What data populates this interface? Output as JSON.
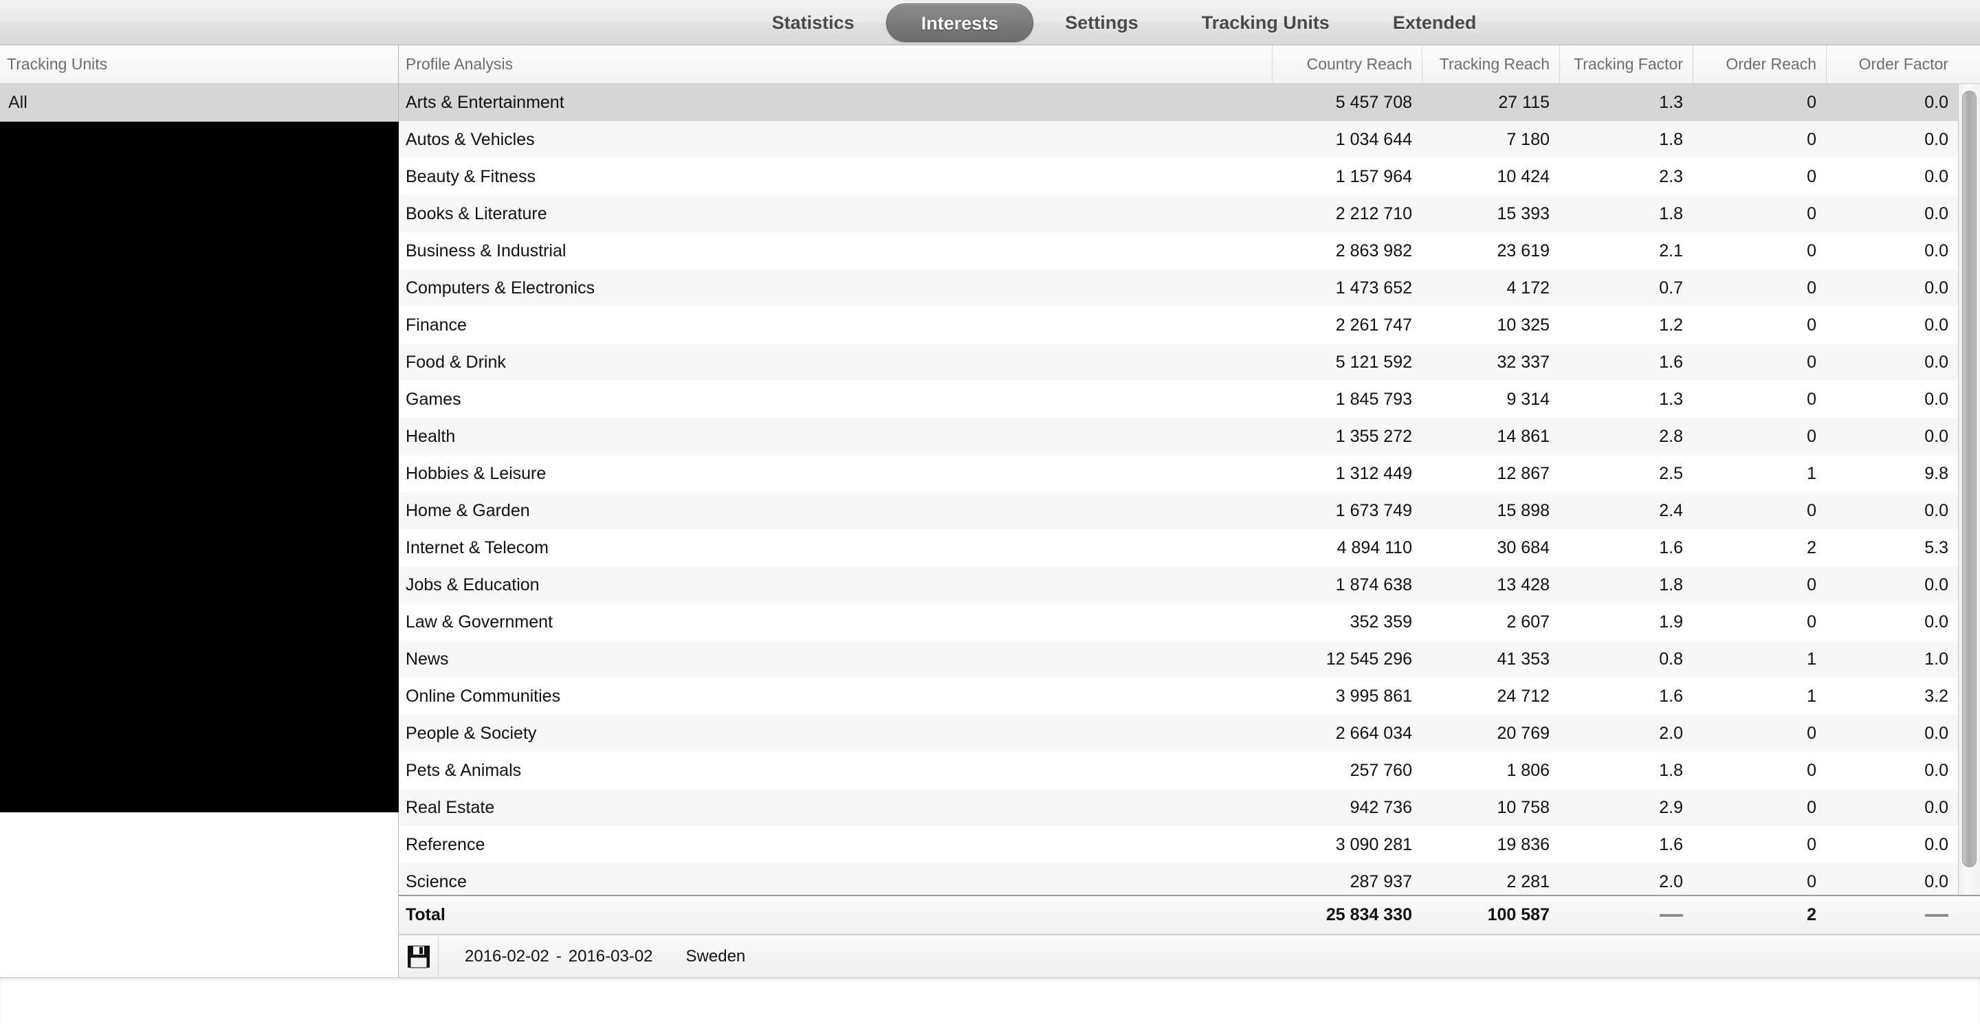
{
  "tabs": [
    {
      "label": "Statistics",
      "active": false
    },
    {
      "label": "Interests",
      "active": true
    },
    {
      "label": "Settings",
      "active": false
    },
    {
      "label": "Tracking Units",
      "active": false
    },
    {
      "label": "Extended",
      "active": false
    }
  ],
  "left_panel": {
    "header": "Tracking Units",
    "items": [
      {
        "label": "All",
        "selected": true
      }
    ]
  },
  "table": {
    "headers": {
      "name": "Profile Analysis",
      "country_reach": "Country Reach",
      "tracking_reach": "Tracking Reach",
      "tracking_factor": "Tracking Factor",
      "order_reach": "Order Reach",
      "order_factor": "Order Factor"
    },
    "rows": [
      {
        "name": "Arts & Entertainment",
        "country_reach": "5 457 708",
        "tracking_reach": "27 115",
        "tracking_factor": "1.3",
        "order_reach": "0",
        "order_factor": "0.0",
        "selected": true
      },
      {
        "name": "Autos & Vehicles",
        "country_reach": "1 034 644",
        "tracking_reach": "7 180",
        "tracking_factor": "1.8",
        "order_reach": "0",
        "order_factor": "0.0",
        "selected": false
      },
      {
        "name": "Beauty & Fitness",
        "country_reach": "1 157 964",
        "tracking_reach": "10 424",
        "tracking_factor": "2.3",
        "order_reach": "0",
        "order_factor": "0.0",
        "selected": false
      },
      {
        "name": "Books & Literature",
        "country_reach": "2 212 710",
        "tracking_reach": "15 393",
        "tracking_factor": "1.8",
        "order_reach": "0",
        "order_factor": "0.0",
        "selected": false
      },
      {
        "name": "Business & Industrial",
        "country_reach": "2 863 982",
        "tracking_reach": "23 619",
        "tracking_factor": "2.1",
        "order_reach": "0",
        "order_factor": "0.0",
        "selected": false
      },
      {
        "name": "Computers & Electronics",
        "country_reach": "1 473 652",
        "tracking_reach": "4 172",
        "tracking_factor": "0.7",
        "order_reach": "0",
        "order_factor": "0.0",
        "selected": false
      },
      {
        "name": "Finance",
        "country_reach": "2 261 747",
        "tracking_reach": "10 325",
        "tracking_factor": "1.2",
        "order_reach": "0",
        "order_factor": "0.0",
        "selected": false
      },
      {
        "name": "Food & Drink",
        "country_reach": "5 121 592",
        "tracking_reach": "32 337",
        "tracking_factor": "1.6",
        "order_reach": "0",
        "order_factor": "0.0",
        "selected": false
      },
      {
        "name": "Games",
        "country_reach": "1 845 793",
        "tracking_reach": "9 314",
        "tracking_factor": "1.3",
        "order_reach": "0",
        "order_factor": "0.0",
        "selected": false
      },
      {
        "name": "Health",
        "country_reach": "1 355 272",
        "tracking_reach": "14 861",
        "tracking_factor": "2.8",
        "order_reach": "0",
        "order_factor": "0.0",
        "selected": false
      },
      {
        "name": "Hobbies & Leisure",
        "country_reach": "1 312 449",
        "tracking_reach": "12 867",
        "tracking_factor": "2.5",
        "order_reach": "1",
        "order_factor": "9.8",
        "selected": false
      },
      {
        "name": "Home & Garden",
        "country_reach": "1 673 749",
        "tracking_reach": "15 898",
        "tracking_factor": "2.4",
        "order_reach": "0",
        "order_factor": "0.0",
        "selected": false
      },
      {
        "name": "Internet & Telecom",
        "country_reach": "4 894 110",
        "tracking_reach": "30 684",
        "tracking_factor": "1.6",
        "order_reach": "2",
        "order_factor": "5.3",
        "selected": false
      },
      {
        "name": "Jobs & Education",
        "country_reach": "1 874 638",
        "tracking_reach": "13 428",
        "tracking_factor": "1.8",
        "order_reach": "0",
        "order_factor": "0.0",
        "selected": false
      },
      {
        "name": "Law & Government",
        "country_reach": "352 359",
        "tracking_reach": "2 607",
        "tracking_factor": "1.9",
        "order_reach": "0",
        "order_factor": "0.0",
        "selected": false
      },
      {
        "name": "News",
        "country_reach": "12 545 296",
        "tracking_reach": "41 353",
        "tracking_factor": "0.8",
        "order_reach": "1",
        "order_factor": "1.0",
        "selected": false
      },
      {
        "name": "Online Communities",
        "country_reach": "3 995 861",
        "tracking_reach": "24 712",
        "tracking_factor": "1.6",
        "order_reach": "1",
        "order_factor": "3.2",
        "selected": false
      },
      {
        "name": "People & Society",
        "country_reach": "2 664 034",
        "tracking_reach": "20 769",
        "tracking_factor": "2.0",
        "order_reach": "0",
        "order_factor": "0.0",
        "selected": false
      },
      {
        "name": "Pets & Animals",
        "country_reach": "257 760",
        "tracking_reach": "1 806",
        "tracking_factor": "1.8",
        "order_reach": "0",
        "order_factor": "0.0",
        "selected": false
      },
      {
        "name": "Real Estate",
        "country_reach": "942 736",
        "tracking_reach": "10 758",
        "tracking_factor": "2.9",
        "order_reach": "0",
        "order_factor": "0.0",
        "selected": false
      },
      {
        "name": "Reference",
        "country_reach": "3 090 281",
        "tracking_reach": "19 836",
        "tracking_factor": "1.6",
        "order_reach": "0",
        "order_factor": "0.0",
        "selected": false
      },
      {
        "name": "Science",
        "country_reach": "287 937",
        "tracking_reach": "2 281",
        "tracking_factor": "2.0",
        "order_reach": "0",
        "order_factor": "0.0",
        "selected": false
      }
    ],
    "total": {
      "label": "Total",
      "country_reach": "25 834 330",
      "tracking_reach": "100 587",
      "tracking_factor": "—",
      "order_reach": "2",
      "order_factor": "—"
    }
  },
  "footer": {
    "save_icon": "floppy-disk-icon",
    "date_from": "2016-02-02",
    "date_separator": "-",
    "date_to": "2016-03-02",
    "country": "Sweden"
  },
  "colors": {
    "active_tab_bg": "#7c7c7c",
    "selected_row_bg": "#d6d6d6",
    "header_text": "#6e6e6e",
    "body_text": "#111111",
    "panel_black": "#000000"
  }
}
